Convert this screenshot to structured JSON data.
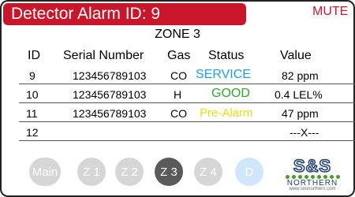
{
  "header": {
    "alarm_title": "Detector Alarm ID: 9",
    "mute_label": "MUTE"
  },
  "zone_title": "ZONE 3",
  "table": {
    "columns": [
      "ID",
      "Serial Number",
      "Gas",
      "Status",
      "Value"
    ],
    "rows": [
      {
        "id": "9",
        "serial": "123456789103",
        "gas": "CO",
        "status": "SERVICE",
        "status_color": "#1aa0e8",
        "value": "82  ppm"
      },
      {
        "id": "10",
        "serial": "123456789103",
        "gas": "H",
        "status": "GOOD",
        "status_color": "#2aa82a",
        "value": "0.4  LEL%"
      },
      {
        "id": "11",
        "serial": "123456789103",
        "gas": "CO",
        "status": "Pre-Alarm",
        "status_color": "#e8dd14",
        "value": "47  ppm"
      },
      {
        "id": "12",
        "serial": "",
        "gas": "",
        "status": "",
        "status_color": "#000000",
        "value": "---X---"
      }
    ]
  },
  "nav": {
    "main": "Main",
    "z1": "Z 1",
    "z2": "Z 2",
    "z3": "Z 3",
    "z4": "Z 4",
    "d": "D",
    "active": "z3"
  },
  "logo": {
    "brand": "S&S",
    "name": "NORTHERN",
    "url": "www.snsnorthern.com"
  },
  "colors": {
    "alarm_red": "#c8172a",
    "nav_inactive": "#d6d6d6",
    "nav_active": "#5a5a5a",
    "nav_d": "#cfe6fb"
  }
}
